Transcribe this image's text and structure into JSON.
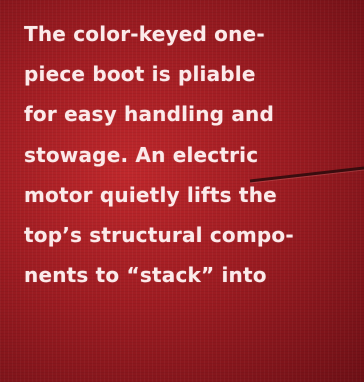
{
  "article": {
    "lines": [
      "The color-keyed one-",
      "piece boot is pliable",
      "for easy handling and",
      "stowage. An electric",
      "motor quietly lifts the",
      "top’s structural compo-",
      "nents to “stack” into"
    ]
  },
  "colors": {
    "background": "#a41e24",
    "text": "#fbeaea",
    "crease": "#2a0a0c"
  }
}
